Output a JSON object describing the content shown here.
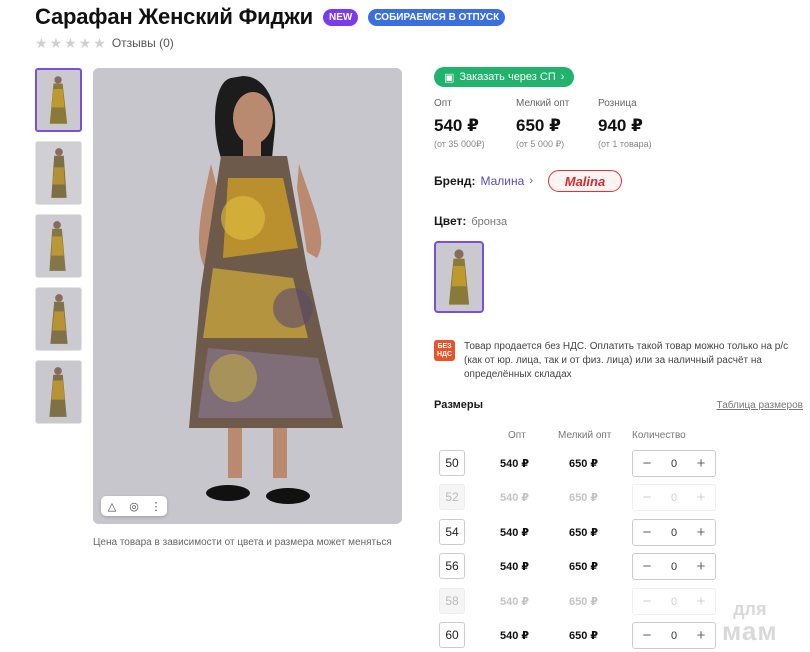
{
  "product": {
    "title": "Сарафан Женский Фиджи",
    "badges": [
      "NEW",
      "СОБИРАЕМСЯ В ОТПУСК"
    ],
    "reviews_label": "Отзывы (0)",
    "rating_stars": 0,
    "price_note": "Цена товара в зависимости от цвета и размера может меняться"
  },
  "sp_button": {
    "label": "Заказать через СП",
    "icon": "bag-icon"
  },
  "prices": [
    {
      "label": "Опт",
      "value": "540 ₽",
      "sub": "(от 35 000₽)"
    },
    {
      "label": "Мелкий опт",
      "value": "650 ₽",
      "sub": "(от 5 000 ₽)"
    },
    {
      "label": "Розница",
      "value": "940 ₽",
      "sub": "(от 1 товара)"
    }
  ],
  "brand": {
    "label": "Бренд:",
    "name": "Малина",
    "logo_text": "Malina"
  },
  "color": {
    "label": "Цвет:",
    "value": "бронза"
  },
  "vat": {
    "icon_line1": "БЕЗ",
    "icon_line2": "НДС",
    "text": "Товар продается без НДС. Оплатить такой товар можно только на р/с (как от юр. лица, так и от физ. лица) или за наличный расчёт на определённых складах"
  },
  "sizes": {
    "title": "Размеры",
    "table_link": "Таблица размеров",
    "headers": {
      "opt": "Опт",
      "small": "Мелкий опт",
      "qty": "Количество"
    },
    "rows": [
      {
        "size": "50",
        "opt": "540 ₽",
        "small": "650 ₽",
        "qty": "0",
        "available": true
      },
      {
        "size": "52",
        "opt": "540 ₽",
        "small": "650 ₽",
        "qty": "0",
        "available": false
      },
      {
        "size": "54",
        "opt": "540 ₽",
        "small": "650 ₽",
        "qty": "0",
        "available": true
      },
      {
        "size": "56",
        "opt": "540 ₽",
        "small": "650 ₽",
        "qty": "0",
        "available": true
      },
      {
        "size": "58",
        "opt": "540 ₽",
        "small": "650 ₽",
        "qty": "0",
        "available": false
      },
      {
        "size": "60",
        "opt": "540 ₽",
        "small": "650 ₽",
        "qty": "0",
        "available": true
      }
    ],
    "minus": "−",
    "plus": "+"
  },
  "watermark": {
    "line1": "для",
    "line2": "мам"
  },
  "colors": {
    "accent": "#7b4fd6",
    "green": "#21b36b",
    "badge_new": "#7c3aed",
    "badge_trip": "#3b6fe0",
    "vat": "#e8542a"
  }
}
